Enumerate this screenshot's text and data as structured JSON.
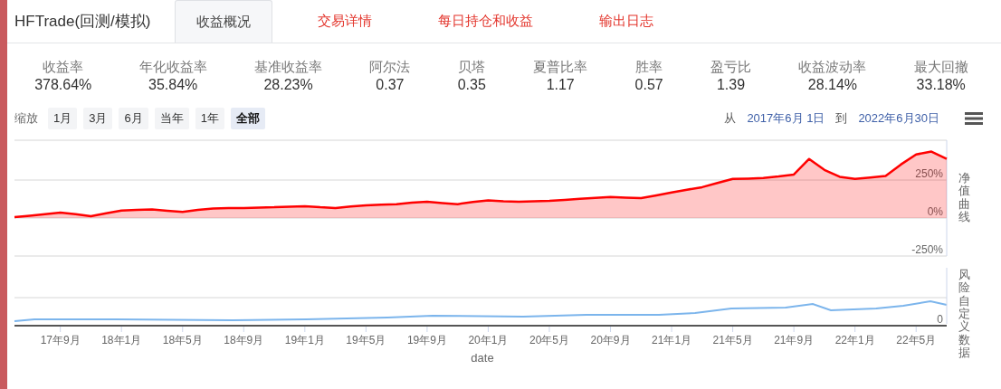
{
  "header": {
    "brand": "HFTrade(回测/模拟)",
    "tabs": [
      {
        "label": "收益概况",
        "selected": true
      },
      {
        "label": "交易详情",
        "selected": false
      },
      {
        "label": "每日持仓和收益",
        "selected": false
      },
      {
        "label": "输出日志",
        "selected": false
      }
    ]
  },
  "stats": [
    {
      "label": "收益率",
      "value": "378.64%"
    },
    {
      "label": "年化收益率",
      "value": "35.84%"
    },
    {
      "label": "基准收益率",
      "value": "28.23%"
    },
    {
      "label": "阿尔法",
      "value": "0.37"
    },
    {
      "label": "贝塔",
      "value": "0.35"
    },
    {
      "label": "夏普比率",
      "value": "1.17"
    },
    {
      "label": "胜率",
      "value": "0.57"
    },
    {
      "label": "盈亏比",
      "value": "1.39"
    },
    {
      "label": "收益波动率",
      "value": "28.14%"
    },
    {
      "label": "最大回撤",
      "value": "33.18%"
    }
  ],
  "zoom": {
    "label": "缩放",
    "buttons": [
      {
        "label": "1月",
        "selected": false
      },
      {
        "label": "3月",
        "selected": false
      },
      {
        "label": "6月",
        "selected": false
      },
      {
        "label": "当年",
        "selected": false
      },
      {
        "label": "1年",
        "selected": false
      },
      {
        "label": "全部",
        "selected": true
      }
    ]
  },
  "range": {
    "from_label": "从",
    "from": "2017年6月 1日",
    "to_label": "到",
    "to": "2022年6月30日"
  },
  "chart": {
    "chart_data": {
      "type": "area",
      "ylabel": "净值曲线",
      "categories": [
        null,
        null,
        null,
        null,
        null,
        null,
        null,
        null,
        null,
        null,
        null,
        null,
        null,
        null,
        null,
        null,
        null,
        null,
        null,
        null,
        null,
        null,
        null,
        null,
        null,
        null,
        null,
        null,
        null,
        null,
        null,
        null,
        null,
        null,
        null,
        null,
        null,
        null,
        null,
        null,
        null,
        null,
        null,
        null,
        null,
        null,
        null,
        null,
        null,
        null,
        null,
        null,
        null,
        null,
        null,
        null,
        null,
        null,
        null,
        null,
        null,
        null
      ],
      "series": [
        {
          "color": "#ff0000",
          "values": [
            5,
            15,
            25,
            35,
            25,
            12,
            30,
            48,
            52,
            55,
            47,
            40,
            52,
            62,
            64,
            65,
            68,
            70,
            74,
            77,
            70,
            65,
            75,
            83,
            87,
            90,
            100,
            107,
            98,
            90,
            105,
            115,
            110,
            107,
            110,
            113,
            118,
            125,
            132,
            137,
            133,
            130,
            148,
            167,
            185,
            202,
            230,
            256,
            258,
            262,
            272,
            285,
            387,
            315,
            270,
            256,
            265,
            275,
            350,
            417,
            435,
            387
          ]
        }
      ],
      "ylim": [
        -250,
        510
      ],
      "yticks": [
        {
          "value": -250,
          "label": "-250%"
        },
        {
          "value": 0,
          "label": "0%"
        },
        {
          "value": 250,
          "label": "250%"
        }
      ]
    },
    "risk_panel": {
      "title": "风险自定义数据",
      "ytick": "0"
    },
    "time_axis": {
      "title": "date",
      "labels": [
        "17年9月",
        "18年1月",
        "18年5月",
        "18年9月",
        "19年1月",
        "19年5月",
        "19年9月",
        "20年1月",
        "20年5月",
        "20年9月",
        "21年1月",
        "21年5月",
        "21年9月",
        "22年1月",
        "22年5月"
      ]
    }
  }
}
